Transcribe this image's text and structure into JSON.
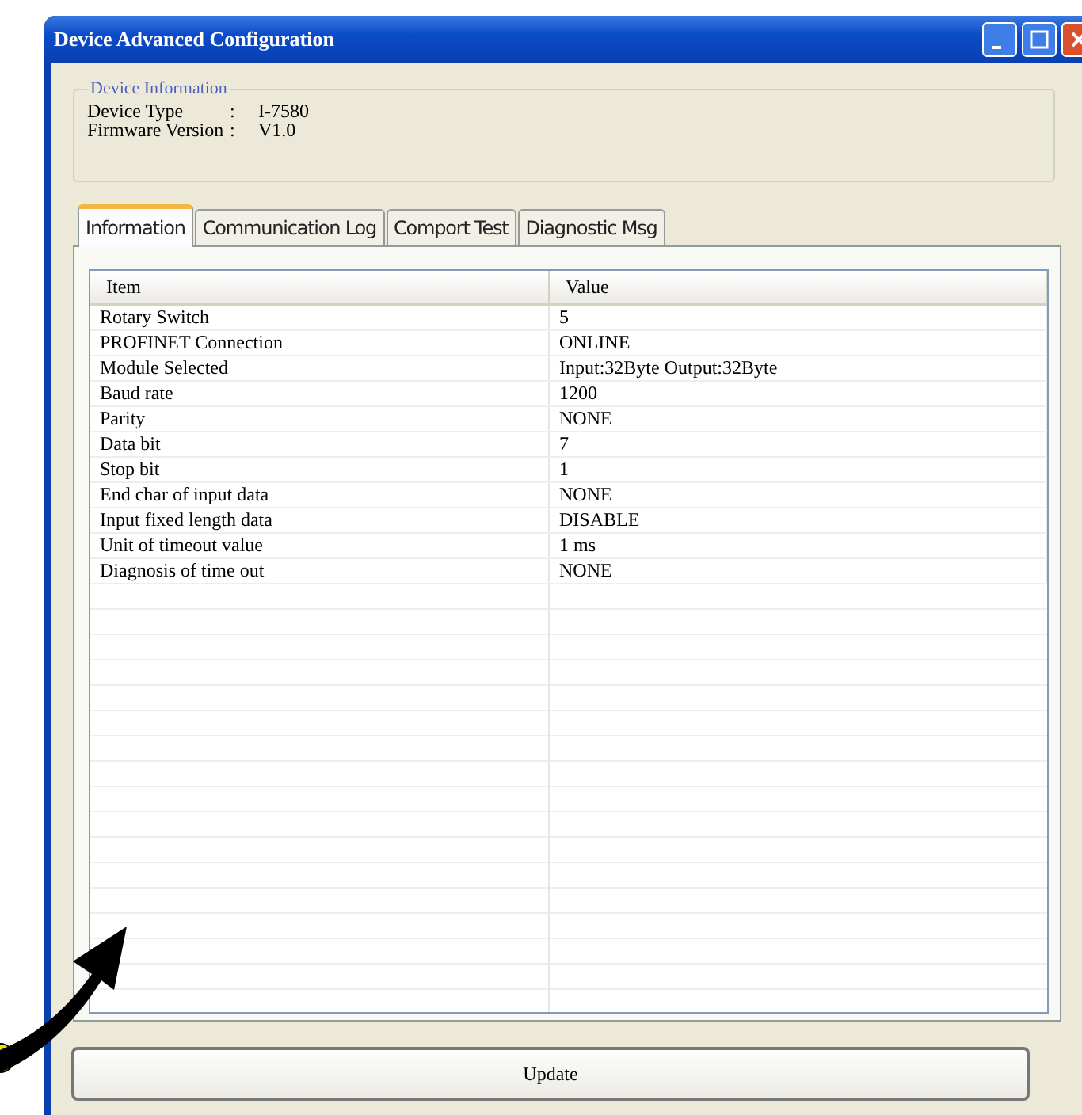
{
  "window": {
    "title": "Device Advanced Configuration"
  },
  "device_information": {
    "title": "Device Information",
    "fields": [
      {
        "label": "Device Type",
        "separator": ":",
        "value": "I-7580"
      },
      {
        "label": "Firmware Version",
        "separator": ":",
        "value": "V1.0"
      }
    ]
  },
  "tabs": [
    {
      "label": "Information",
      "selected": true
    },
    {
      "label": "Communication Log",
      "selected": false
    },
    {
      "label": "Comport Test",
      "selected": false
    },
    {
      "label": "Diagnostic Msg",
      "selected": false
    }
  ],
  "table": {
    "columns": [
      "Item",
      "Value"
    ],
    "rows": [
      [
        "Rotary Switch",
        "5"
      ],
      [
        "PROFINET Connection",
        "ONLINE"
      ],
      [
        "Module Selected",
        "Input:32Byte Output:32Byte"
      ],
      [
        "Baud rate",
        "1200"
      ],
      [
        "Parity",
        "NONE"
      ],
      [
        "Data bit",
        "7"
      ],
      [
        "Stop bit",
        "1"
      ],
      [
        "End char of input data",
        "NONE"
      ],
      [
        "Input fixed length data",
        "DISABLE"
      ],
      [
        "Unit of timeout value",
        "1 ms"
      ],
      [
        "Diagnosis of time out",
        "NONE"
      ]
    ]
  },
  "buttons": [
    "Update"
  ]
}
